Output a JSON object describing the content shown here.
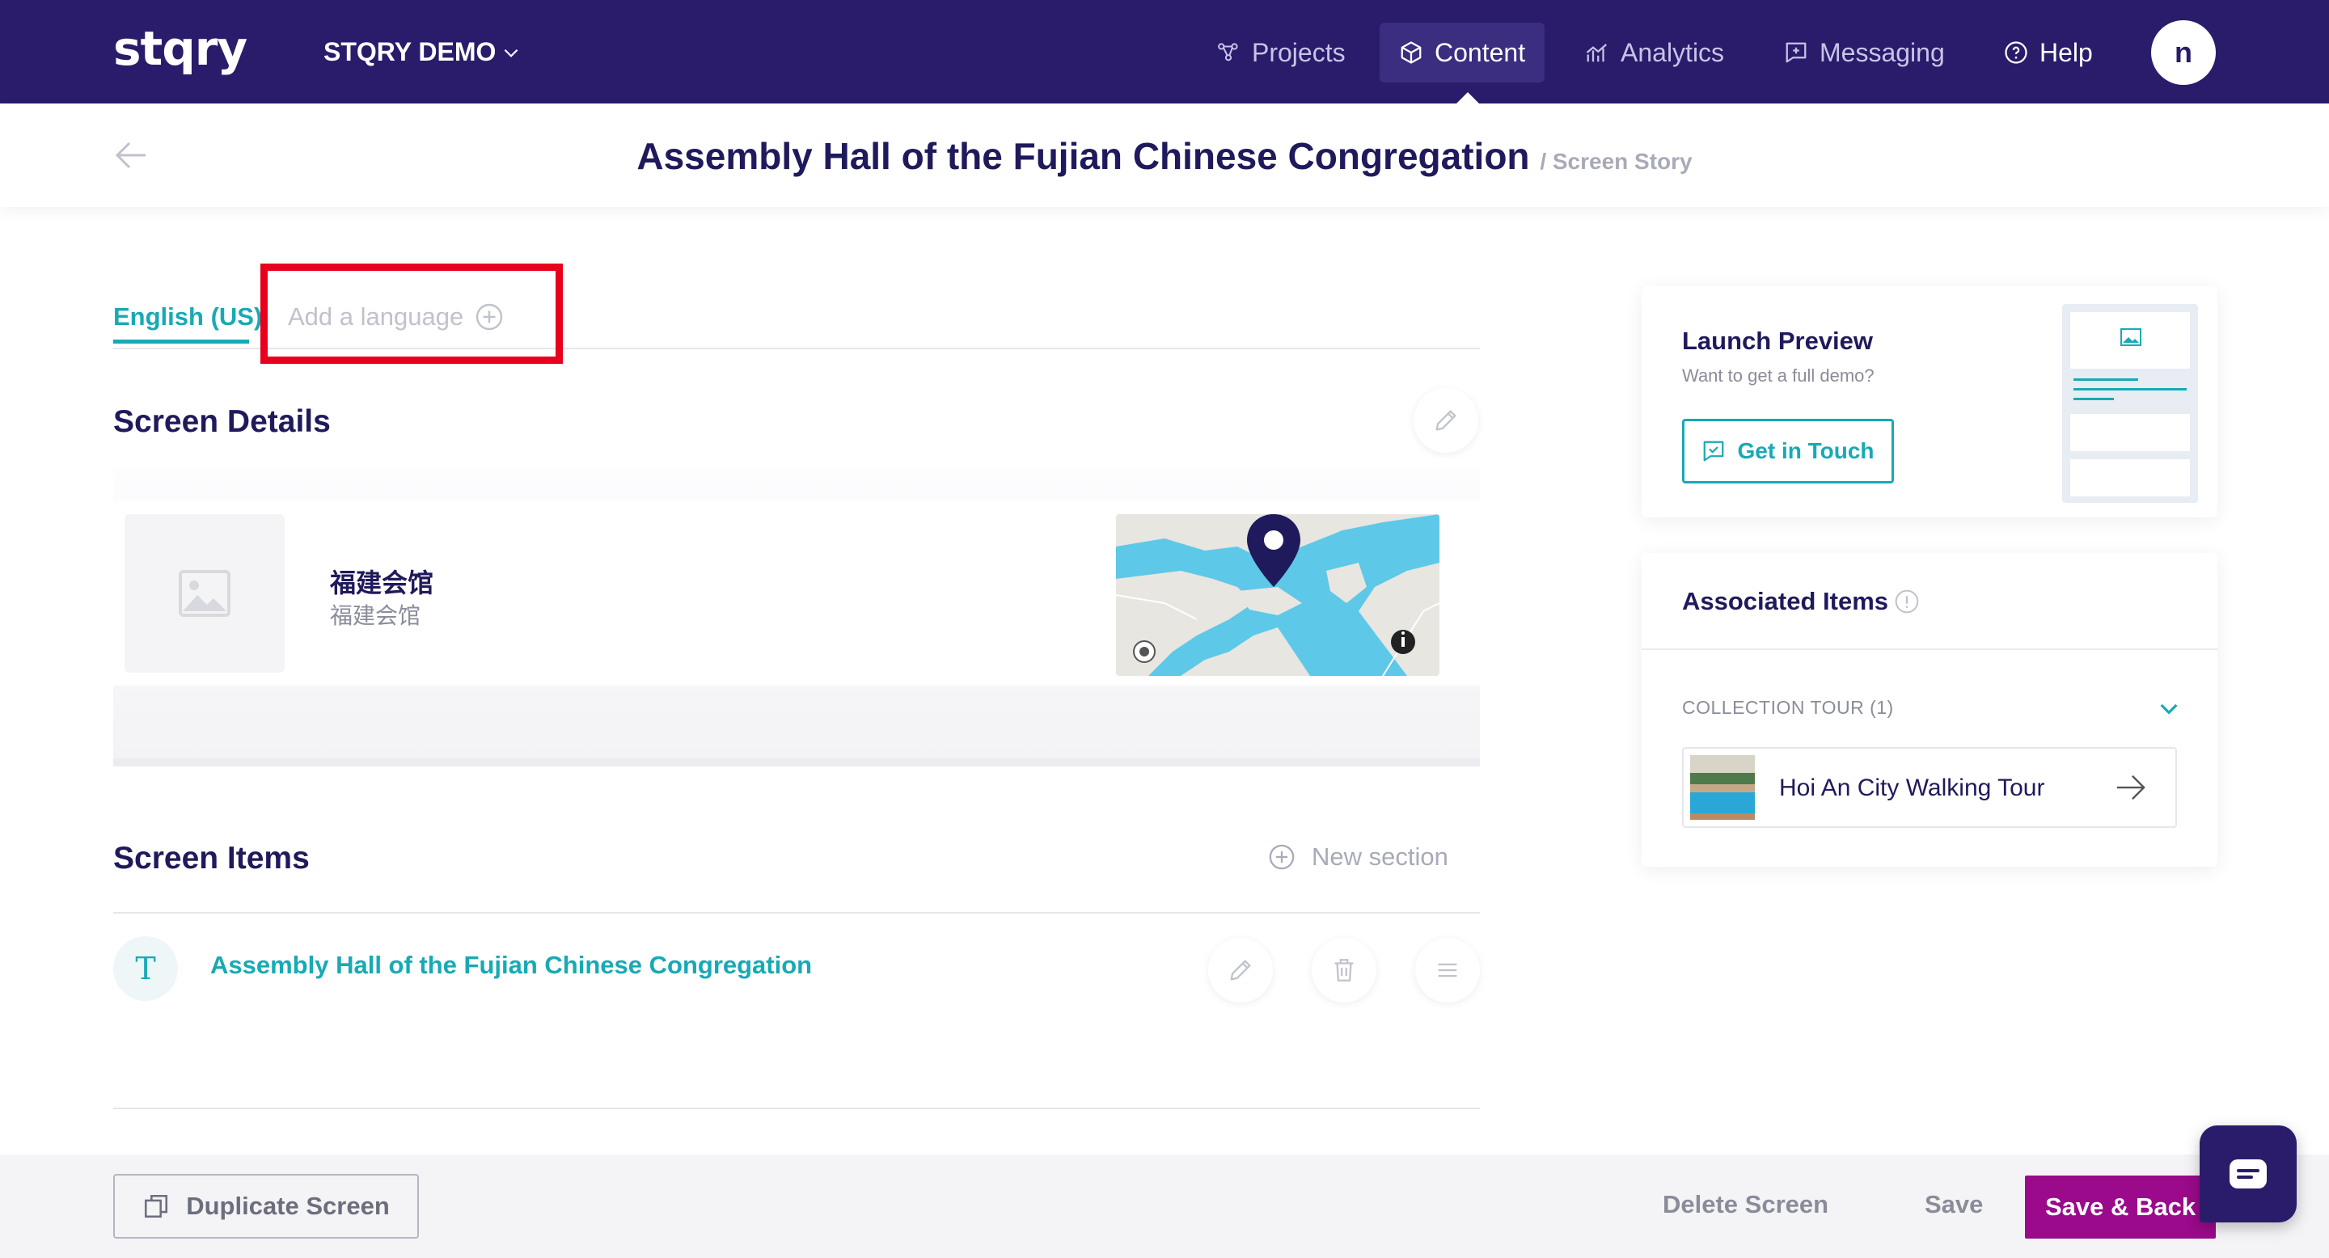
{
  "nav": {
    "logo": "stqry",
    "org": "STQRY DEMO",
    "items": [
      {
        "label": "Projects",
        "icon": "projects-icon"
      },
      {
        "label": "Content",
        "icon": "content-box-icon"
      },
      {
        "label": "Analytics",
        "icon": "analytics-icon"
      },
      {
        "label": "Messaging",
        "icon": "messaging-icon"
      },
      {
        "label": "Help",
        "icon": "help-icon"
      }
    ],
    "active": "Content",
    "avatar_initial": "n"
  },
  "header": {
    "title": "Assembly Hall of the Fujian Chinese Congregation",
    "subtitle": "/ Screen Story"
  },
  "languages": {
    "current": "English (US)",
    "add_label": "Add a language"
  },
  "screen_details": {
    "heading": "Screen Details",
    "title": "福建会馆",
    "subtitle": "福建会馆"
  },
  "screen_items": {
    "heading": "Screen Items",
    "new_section_label": "New section",
    "items": [
      {
        "type_glyph": "T",
        "title": "Assembly Hall of the Fujian Chinese Congregation"
      }
    ]
  },
  "launch_preview": {
    "title": "Launch Preview",
    "subtitle": "Want to get a full demo?",
    "button_label": "Get in Touch"
  },
  "associated_items": {
    "title": "Associated Items",
    "group_label": "COLLECTION TOUR (1)",
    "items": [
      {
        "name": "Hoi An City Walking Tour"
      }
    ]
  },
  "footer": {
    "duplicate_label": "Duplicate Screen",
    "delete_label": "Delete Screen",
    "save_label": "Save",
    "save_back_label": "Save & Back"
  },
  "colors": {
    "nav_bg": "#2a1c6b",
    "accent": "#17aab5",
    "primary_button": "#9a0a8b",
    "highlight": "#e8001c"
  }
}
